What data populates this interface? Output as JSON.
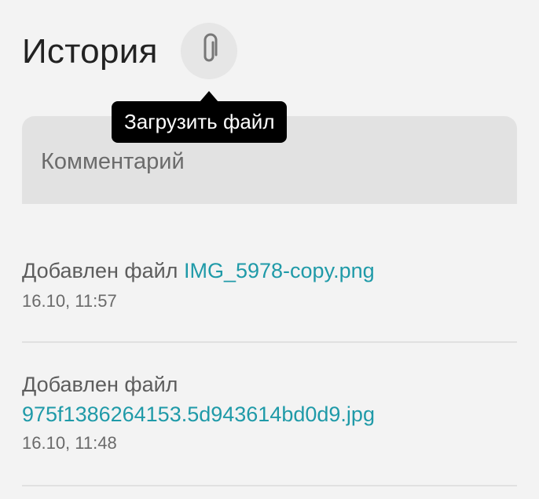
{
  "header": {
    "title": "История"
  },
  "attach": {
    "icon": "paperclip-icon",
    "tooltip": "Загрузить файл"
  },
  "comment": {
    "placeholder": "Комментарий"
  },
  "history": [
    {
      "action": "Добавлен файл",
      "file_name": "IMG_5978-copy.png",
      "time": "16.10, 11:57"
    },
    {
      "action": "Добавлен файл",
      "file_name": "975f1386264153.5d943614bd0d9.jpg",
      "time": "16.10, 11:48"
    }
  ],
  "colors": {
    "background": "#f3f3f3",
    "link": "#1f9aa8",
    "tooltip_bg": "#000000",
    "input_bg": "#e2e2e2"
  }
}
